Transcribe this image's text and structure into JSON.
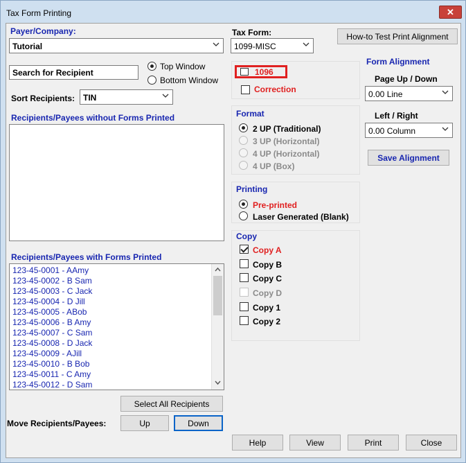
{
  "window": {
    "title": "Tax Form Printing",
    "close_label": "✕"
  },
  "payer": {
    "label": "Payer/Company:",
    "value": "Tutorial"
  },
  "tax_form": {
    "label": "Tax Form:",
    "value": "1099-MISC"
  },
  "howto_button": "How-to Test Print  Alignment",
  "search": {
    "value": "Search for Recipient"
  },
  "window_position": {
    "top_label": "Top Window",
    "bottom_label": "Bottom Window",
    "selected": "top"
  },
  "sort": {
    "label": "Sort Recipients:",
    "value": "TIN"
  },
  "without_forms": {
    "label": "Recipients/Payees without Forms Printed",
    "items": []
  },
  "with_forms": {
    "label": "Recipients/Payees with Forms Printed",
    "items": [
      "123-45-0001 - AAmy",
      "123-45-0002 - B Sam",
      "123-45-0003 - C Jack",
      "123-45-0004 - D Jill",
      "123-45-0005 - ABob",
      "123-45-0006 - B Amy",
      "123-45-0007 - C Sam",
      "123-45-0008 - D Jack",
      "123-45-0009 - AJill",
      "123-45-0010 - B Bob",
      "123-45-0011 - C Amy",
      "123-45-0012 - D Sam"
    ]
  },
  "form_options": {
    "f1096_label": "1096",
    "correction_label": "Correction"
  },
  "format": {
    "label": "Format",
    "options": [
      "2 UP (Traditional)",
      "3 UP (Horizontal)",
      "4 UP (Horizontal)",
      "4 UP (Box)"
    ],
    "selected_index": 0
  },
  "printing": {
    "label": "Printing",
    "preprinted_label": "Pre-printed",
    "laser_label": "Laser Generated (Blank)",
    "selected": "preprinted"
  },
  "copy": {
    "label": "Copy",
    "options": [
      {
        "label": "Copy A",
        "checked": true,
        "enabled": true
      },
      {
        "label": "Copy B",
        "checked": false,
        "enabled": true
      },
      {
        "label": "Copy C",
        "checked": false,
        "enabled": true
      },
      {
        "label": "Copy D",
        "checked": false,
        "enabled": false
      },
      {
        "label": "Copy 1",
        "checked": false,
        "enabled": true
      },
      {
        "label": "Copy 2",
        "checked": false,
        "enabled": true
      }
    ]
  },
  "alignment": {
    "label": "Form Alignment",
    "page_label": "Page Up / Down",
    "page_value": "0.00 Line",
    "lr_label": "Left / Right",
    "lr_value": "0.00 Column",
    "save_label": "Save  Alignment"
  },
  "buttons": {
    "select_all": "Select All Recipients",
    "move_label": "Move Recipients/Payees:",
    "up": "Up",
    "down": "Down",
    "help": "Help",
    "view": "View",
    "print": "Print",
    "close": "Close"
  }
}
